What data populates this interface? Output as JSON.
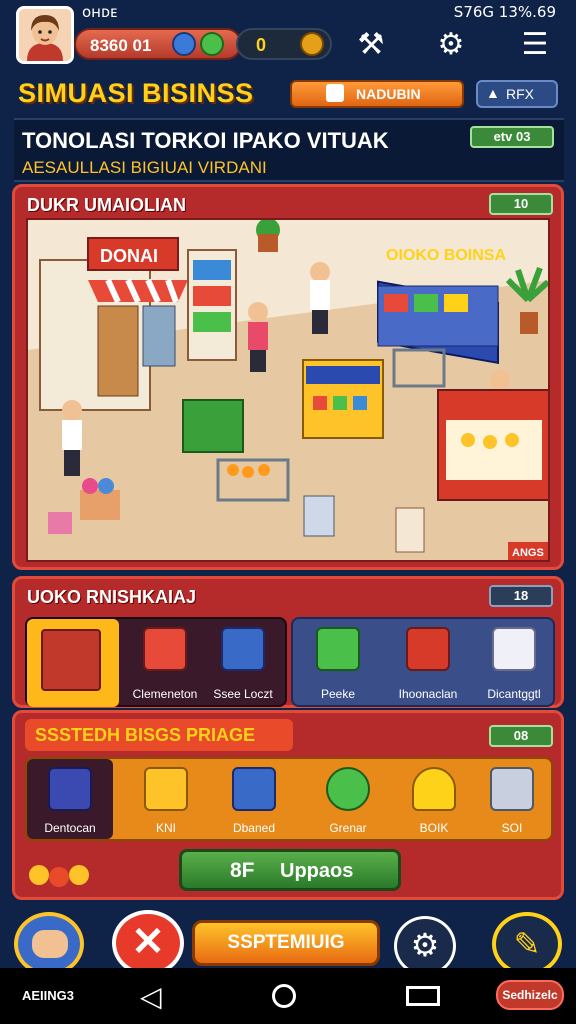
{
  "status": {
    "left": "ᴏʜᴅᴇ",
    "right": "S76G  13%.69"
  },
  "topbar": {
    "money": "8360 01",
    "energy": "0",
    "icons": [
      "person-pin-icon",
      "gear-icon",
      "menu-icon"
    ]
  },
  "header": {
    "title": "SIMUASI BISINSS",
    "nav_button": "NADUBIN",
    "rfx_button": "RFX"
  },
  "headline": {
    "title": "TONOLASI TORKOI IPAKO VITUAK",
    "subtitle": "AESAULLASI BIGIUAI VIRDANI",
    "tag": "etv 03"
  },
  "scene": {
    "heading": "DUKR UMAIOLIAN",
    "tag": "10",
    "shop_sign": "DONAI",
    "store_sign": "OIOKO BOINSA",
    "corner_badge": "ANGS"
  },
  "category": {
    "heading": "UOKO RNISHKAIAJ",
    "tag": "18",
    "left_items": [
      {
        "label": "",
        "icon": "market-stall-icon"
      },
      {
        "label": "Clemeneton",
        "icon": "shop-icon"
      },
      {
        "label": "Ssee Loczt",
        "icon": "vending-machine-icon"
      }
    ],
    "right_items": [
      {
        "label": "Peeke",
        "icon": "shelf-icon"
      },
      {
        "label": "Ihoonaclan",
        "icon": "cabinet-icon"
      },
      {
        "label": "Dicantggtl",
        "icon": "box-icon"
      }
    ]
  },
  "system": {
    "heading": "SSSTEDH BISGS PRIAGE",
    "tag": "08",
    "items": [
      {
        "label": "Dentocan",
        "icon": "card-reader-icon"
      },
      {
        "label": "KNI",
        "icon": "machine-icon"
      },
      {
        "label": "Dbaned",
        "icon": "register-icon"
      },
      {
        "label": "Grenar",
        "icon": "badge-icon"
      },
      {
        "label": "BOIK",
        "icon": "lamp-icon"
      },
      {
        "label": "SOI",
        "icon": "terminal-icon"
      }
    ]
  },
  "upgrade": {
    "label": "Uppaos",
    "prefix": "8F"
  },
  "bottom": {
    "main_button": "SSPTEMIUIG",
    "nav_left": "AEIING3",
    "nav_right": "Sedhizelc"
  },
  "colors": {
    "accent": "#ffd21a",
    "panel": "#b52a2a",
    "upgrade": "#3a8a3a",
    "orange": "#e88a1a"
  }
}
